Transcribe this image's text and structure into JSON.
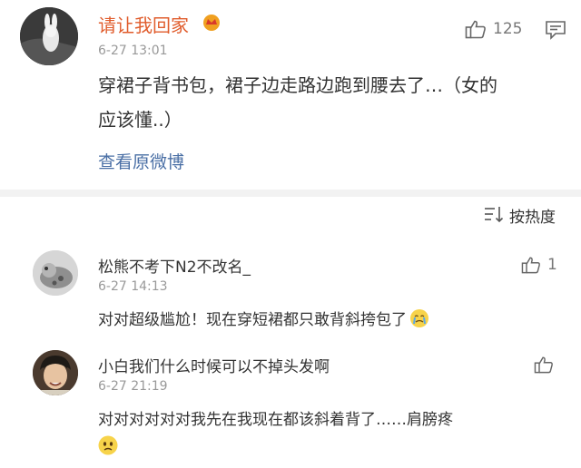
{
  "post": {
    "username": "请让我回家",
    "time": "6-27 13:01",
    "like_count": "125",
    "text_line1": "穿裙子背书包，裙子边走路边跑到腰去了…（女的",
    "text_line2": "应该懂..）",
    "view_original": "查看原微博"
  },
  "sort": {
    "label": "按热度"
  },
  "comments": [
    {
      "username": "松熊不考下N2不改名_",
      "time": "6-27 14:13",
      "like_count": "1",
      "text": "对对超级尴尬！现在穿短裙都只敢背斜挎包了"
    },
    {
      "username": "小白我们什么时候可以不掉头发啊",
      "time": "6-27 21:19",
      "like_count": "",
      "text": "对对对对对对我先在我现在都该斜着背了……肩膀疼"
    }
  ],
  "colors": {
    "username": "#e05c2c",
    "link": "#4a6fa5",
    "muted": "#999999",
    "divider": "#f2f2f2"
  },
  "icons": [
    "thumbs-up-icon",
    "comment-icon",
    "sort-icon",
    "cry-emoji-icon",
    "sad-emoji-icon",
    "crown-badge-icon"
  ]
}
